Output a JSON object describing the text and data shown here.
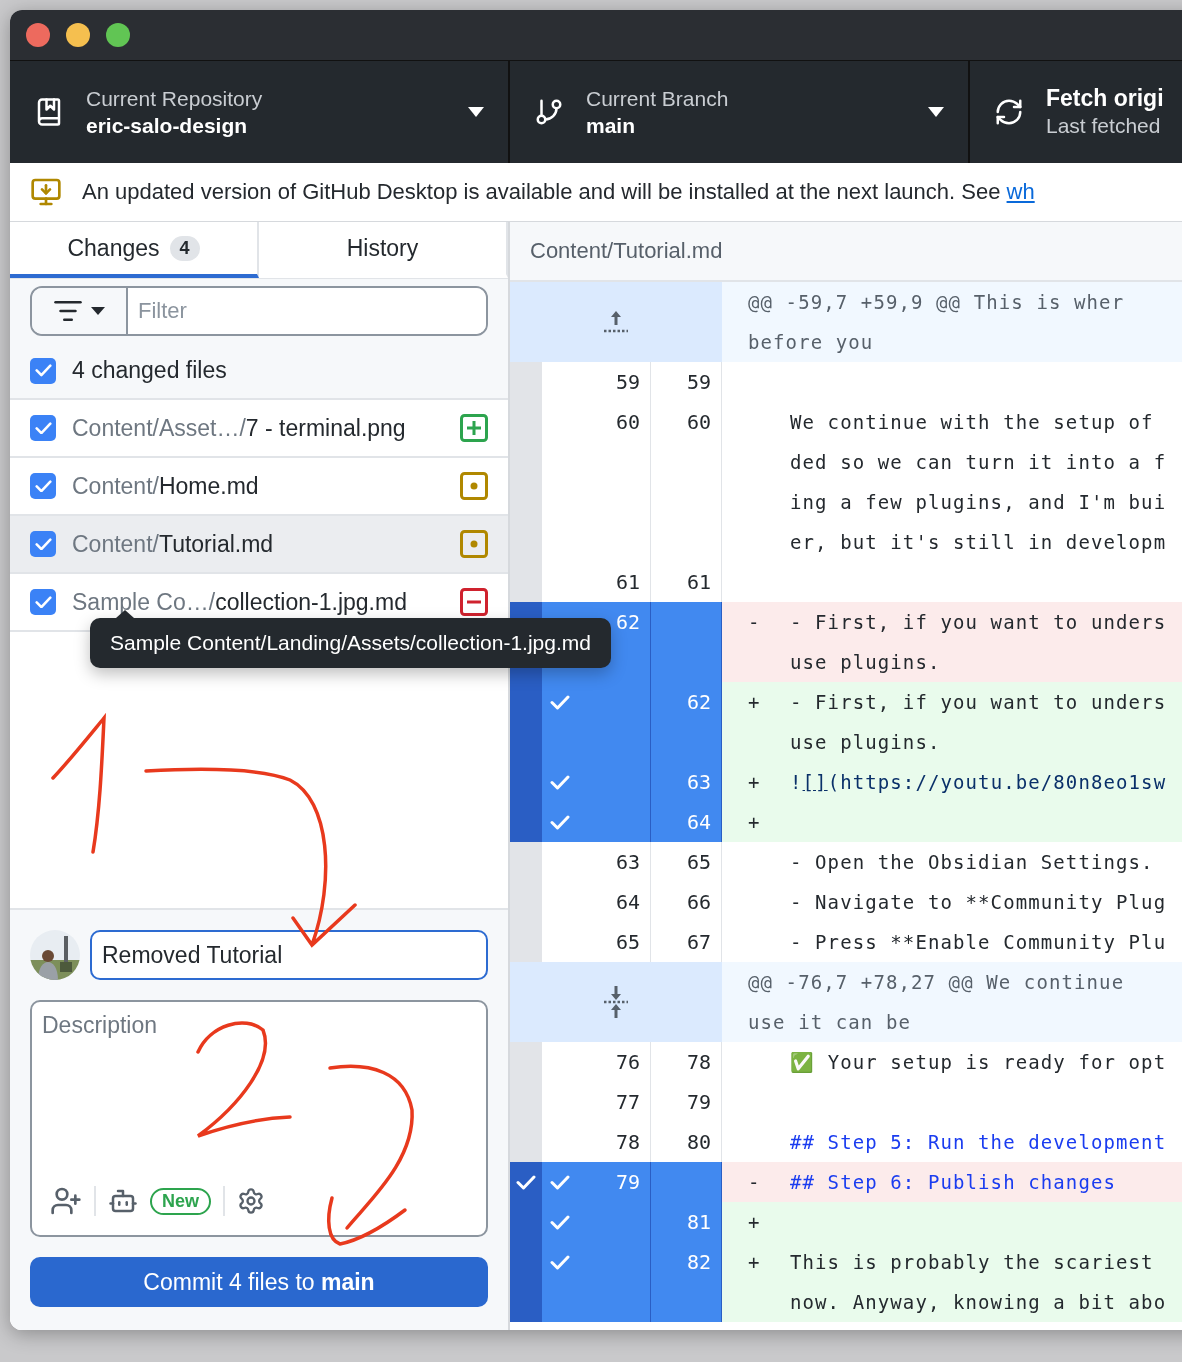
{
  "toolbar": {
    "repository": {
      "label": "Current Repository",
      "value": "eric-salo-design"
    },
    "branch": {
      "label": "Current Branch",
      "value": "main"
    },
    "fetch": {
      "label": "Fetch origi",
      "detail": "Last fetched"
    }
  },
  "banner": {
    "text": "An updated version of GitHub Desktop is available and will be installed at the next launch. See ",
    "link": "wh"
  },
  "tabs": [
    {
      "label": "Changes",
      "count": "4",
      "selected": true
    },
    {
      "label": "History",
      "selected": false
    }
  ],
  "filter": {
    "placeholder": "Filter"
  },
  "changes_header": {
    "label": "4 changed files",
    "checked": true
  },
  "files": [
    {
      "dir": "Content/Asset…/",
      "name": "7 - terminal.png",
      "kind": "added",
      "checked": true,
      "selected": false
    },
    {
      "dir": "Content/",
      "name": "Home.md",
      "kind": "modified",
      "checked": true,
      "selected": false
    },
    {
      "dir": "Content/",
      "name": "Tutorial.md",
      "kind": "modified",
      "checked": true,
      "selected": true
    },
    {
      "dir": "Sample Co…/",
      "name": "collection-1.jpg.md",
      "kind": "deleted",
      "checked": true,
      "selected": false,
      "tooltip": "Sample Content/Landing/Assets/collection-1.jpg.md"
    }
  ],
  "commit": {
    "summary": "Removed Tutorial",
    "description_placeholder": "Description",
    "badge": "New",
    "button": "Commit 4 files to **main**"
  },
  "diff": {
    "path": "Content/Tutorial.md",
    "rows": [
      {
        "kind": "hunk",
        "lines": [
          "@@ -59,7 +59,9 @@ This is wher",
          "before you"
        ]
      },
      {
        "kind": "context",
        "old": "59",
        "new": "59"
      },
      {
        "kind": "context",
        "old": "60",
        "new": "60",
        "lines": [
          "We continue with the setup of",
          "ded so we can turn it into a f",
          "ing a few plugins, and I'm bui",
          "er, but it's still in developm"
        ]
      },
      {
        "kind": "context",
        "old": "61",
        "new": "61"
      },
      {
        "kind": "deleted",
        "old": "62",
        "marker": "-",
        "selected": true,
        "hunk_checked": false,
        "lines": [
          "- First, if you want to unders",
          "use plugins."
        ]
      },
      {
        "kind": "added",
        "new": "62",
        "marker": "+",
        "selected": true,
        "hunk_checked": false,
        "lines": [
          "- First, if you want to unders",
          "use plugins."
        ]
      },
      {
        "kind": "added",
        "new": "63",
        "marker": "+",
        "selected": true,
        "hunk_checked": false,
        "parts": [
          {
            "text": "!"
          },
          {
            "text": "[]",
            "link": true
          },
          {
            "text": "(https://youtu.be/80n8eo1sw"
          }
        ]
      },
      {
        "kind": "added",
        "new": "64",
        "marker": "+",
        "selected": true,
        "hunk_checked": false
      },
      {
        "kind": "context",
        "old": "63",
        "new": "65",
        "lines": [
          "- Open the Obsidian Settings."
        ]
      },
      {
        "kind": "context",
        "old": "64",
        "new": "66",
        "lines": [
          "- Navigate to **Community Plug"
        ]
      },
      {
        "kind": "context",
        "old": "65",
        "new": "67",
        "lines": [
          "- Press **Enable Community Plu"
        ]
      },
      {
        "kind": "hunk",
        "lines": [
          "@@ -76,7 +78,27 @@ We continue",
          "use it can be"
        ]
      },
      {
        "kind": "context",
        "old": "76",
        "new": "78",
        "lines": [
          "✅ Your setup is ready for opt"
        ]
      },
      {
        "kind": "context",
        "old": "77",
        "new": "79"
      },
      {
        "kind": "context",
        "old": "78",
        "new": "80",
        "lines": [
          "## Step 5: Run the development"
        ]
      },
      {
        "kind": "deleted",
        "old": "79",
        "marker": "-",
        "selected": true,
        "hunk_checked": true,
        "lines": [
          "## Step 6: Publish changes"
        ]
      },
      {
        "kind": "added",
        "new": "81",
        "marker": "+",
        "selected": true,
        "hunk_checked": false
      },
      {
        "kind": "added",
        "new": "82",
        "marker": "+",
        "selected": true,
        "hunk_checked": false,
        "lines": [
          "This is probably the scariest",
          "now. Anyway, knowing a bit abo"
        ]
      }
    ]
  }
}
